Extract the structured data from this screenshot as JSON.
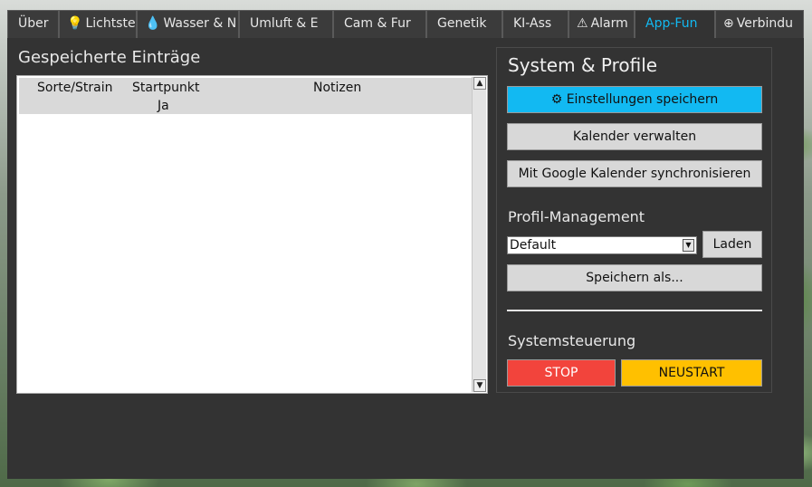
{
  "tabs": [
    {
      "icon": "",
      "label": "Über"
    },
    {
      "icon": "💡",
      "label": "Lichtste"
    },
    {
      "icon": "💧",
      "label": "Wasser & N"
    },
    {
      "icon": "",
      "label": "Umluft & E"
    },
    {
      "icon": "",
      "label": "Cam & Fur"
    },
    {
      "icon": "",
      "label": "Genetik"
    },
    {
      "icon": "",
      "label": "KI-Ass"
    },
    {
      "icon": "⚠",
      "label": "Alarm"
    },
    {
      "icon": "",
      "label": "App-Fun"
    },
    {
      "icon": "⊕",
      "label": "Verbindu"
    }
  ],
  "active_tab_index": 8,
  "left": {
    "title": "Gespeicherte Einträge",
    "columns": [
      "Sorte/Strain",
      "Startpunkt",
      "Notizen"
    ],
    "rows": [
      {
        "sorte": "",
        "startpunkt": "Ja",
        "notizen": ""
      }
    ]
  },
  "panel": {
    "title": "System & Profile",
    "save_settings": "⚙ Einstellungen speichern",
    "manage_calendar": " Kalender verwalten",
    "sync_google": " Mit Google Kalender synchronisieren",
    "profile_title": "Profil-Management",
    "profile_selected": "Default",
    "load_label": "Laden",
    "save_as_label": "Speichern als...",
    "system_title": "Systemsteuerung",
    "stop_label": "STOP",
    "restart_label": "NEUSTART"
  },
  "colors": {
    "accent": "#12b9f2",
    "stop": "#f2443c",
    "restart": "#ffc000"
  }
}
